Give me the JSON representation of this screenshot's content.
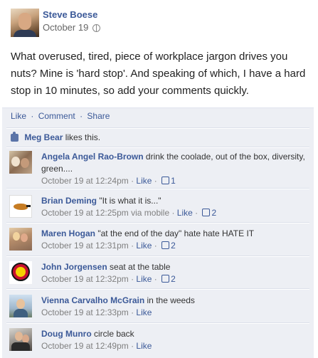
{
  "post": {
    "author": "Steve Boese",
    "time": "October 19",
    "text": "What overused, tired, piece of workplace jargon drives you nuts? Mine is 'hard stop'. And speaking of which, I have a hard stop in 10 minutes, so add your comments quickly."
  },
  "actions": {
    "like": "Like",
    "comment": "Comment",
    "share": "Share",
    "separator": "·"
  },
  "likes": {
    "name": "Meg Bear",
    "suffix": "likes this."
  },
  "comments": [
    {
      "name": "Angela Angel Rao-Brown",
      "text": "drink the coolade, out of the box, diversity, green....",
      "time": "October 19 at 12:24pm",
      "via": "",
      "like": "Like",
      "count": "1"
    },
    {
      "name": "Brian Deming",
      "text": "\"It is what it is...\"",
      "time": "October 19 at 12:25pm",
      "via": "via mobile",
      "like": "Like",
      "count": "2"
    },
    {
      "name": "Maren Hogan",
      "text": "\"at the end of the day\" hate hate HATE IT",
      "time": "October 19 at 12:31pm",
      "via": "",
      "like": "Like",
      "count": "2"
    },
    {
      "name": "John Jorgensen",
      "text": "seat at the table",
      "time": "October 19 at 12:32pm",
      "via": "",
      "like": "Like",
      "count": "2"
    },
    {
      "name": "Vienna Carvalho McGrain",
      "text": "in the weeds",
      "time": "October 19 at 12:33pm",
      "via": "",
      "like": "Like",
      "count": ""
    },
    {
      "name": "Doug Munro",
      "text": "circle back",
      "time": "October 19 at 12:49pm",
      "via": "",
      "like": "Like",
      "count": ""
    }
  ]
}
